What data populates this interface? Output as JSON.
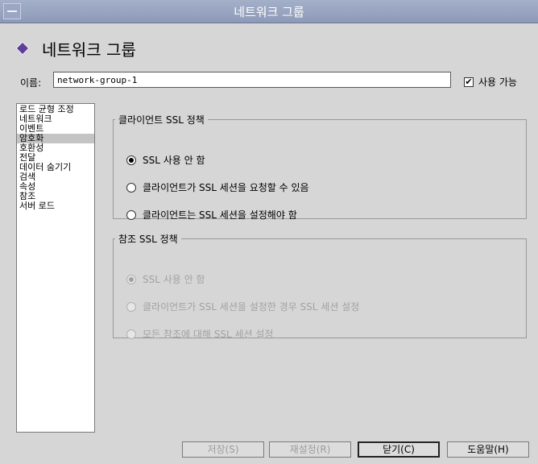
{
  "window": {
    "title": "네트워크 그룹"
  },
  "header": {
    "title": "네트워크 그룹"
  },
  "name_field": {
    "label": "이름:",
    "value": "network-group-1"
  },
  "enable": {
    "label": "사용 가능",
    "checked": true,
    "check_mark": "✔"
  },
  "sidebar": {
    "items": [
      {
        "label": "로드 균형 조정",
        "selected": false
      },
      {
        "label": "네트워크",
        "selected": false
      },
      {
        "label": "이벤트",
        "selected": false
      },
      {
        "label": "암호화",
        "selected": true
      },
      {
        "label": "호환성",
        "selected": false
      },
      {
        "label": "전달",
        "selected": false
      },
      {
        "label": "데이터 숨기기",
        "selected": false
      },
      {
        "label": "검색",
        "selected": false
      },
      {
        "label": "속성",
        "selected": false
      },
      {
        "label": "참조",
        "selected": false
      },
      {
        "label": "서버 로드",
        "selected": false
      }
    ]
  },
  "client_ssl": {
    "title": "클라이언트 SSL 정책",
    "options": [
      {
        "label": "SSL 사용 안 함",
        "selected": true
      },
      {
        "label": "클라이언트가 SSL 세션을 요청할 수 있음",
        "selected": false
      },
      {
        "label": "클라이언트는 SSL 세션을 설정해야 함",
        "selected": false
      }
    ]
  },
  "referral_ssl": {
    "title": "참조 SSL 정책",
    "options": [
      {
        "label": "SSL 사용 안 함",
        "selected": true
      },
      {
        "label": "클라이언트가 SSL 세션을 설정한 경우 SSL 세션 설정",
        "selected": false
      },
      {
        "label": "모든 참조에 대해 SSL 세션 설정",
        "selected": false
      }
    ]
  },
  "buttons": {
    "save": "저장(S)",
    "reset": "재설정(R)",
    "close": "닫기(C)",
    "help": "도움말(H)"
  }
}
